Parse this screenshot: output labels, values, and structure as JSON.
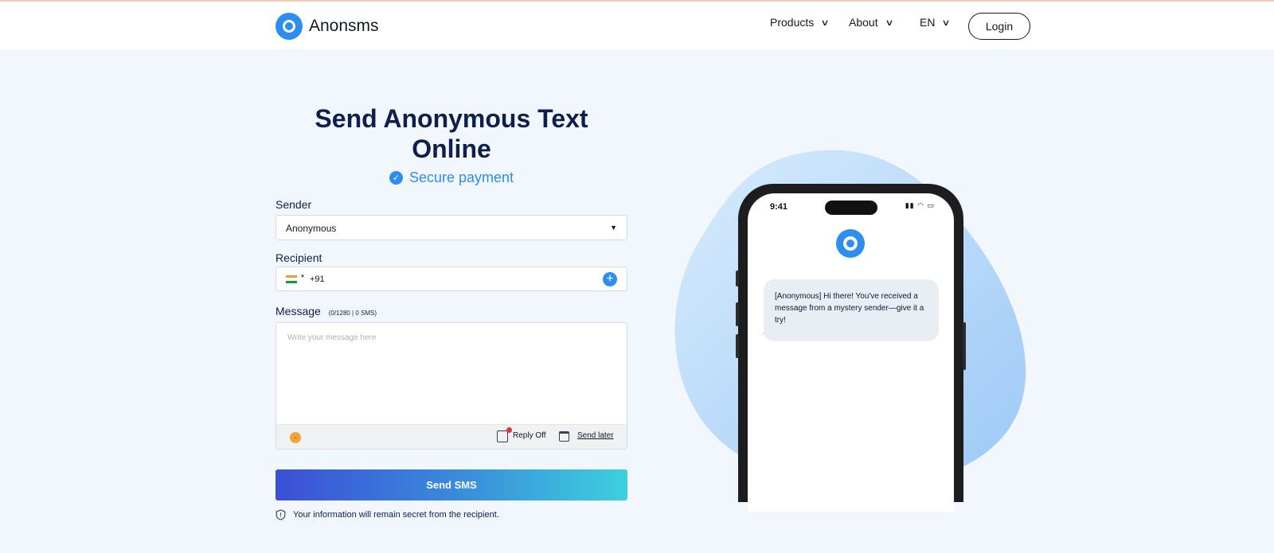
{
  "header": {
    "brand": "Anonsms",
    "nav": [
      {
        "label": "Products",
        "chevron": "∨"
      },
      {
        "label": "About",
        "chevron": "∨"
      },
      {
        "label": "EN",
        "chevron": "∨"
      }
    ],
    "login_label": "Login"
  },
  "hero": {
    "title": "Send Anonymous Text Online",
    "secure_label": "Secure payment"
  },
  "form": {
    "sender_label": "Sender",
    "sender_value": "Anonymous",
    "recipient_label": "Recipient",
    "recipient_country": "India",
    "recipient_dial_code": "+91",
    "message_label": "Message",
    "message_counter": "(0/1280 | 0 SMS)",
    "message_placeholder": "Write your message here",
    "reply_label": "Reply Off",
    "send_later_label": "Send later",
    "send_button_label": "Send SMS",
    "privacy_note": "Your information will remain secret from the recipient."
  },
  "preview": {
    "time": "9:41",
    "message": "[Anonymous] Hi there! You've received a message from a mystery sender—give it a try!"
  },
  "colors": {
    "accent": "#2e8df0",
    "title": "#0c1f4d",
    "background": "#f1f7fd",
    "button_gradient_start": "#3b4fd6",
    "button_gradient_end": "#3dd0dd"
  },
  "icons": [
    "logo-icon",
    "chevron-down-icon",
    "check-circle-icon",
    "caret-down-icon",
    "india-flag-icon",
    "plus-circle-icon",
    "emoji-icon",
    "reply-icon",
    "calendar-icon",
    "shield-icon"
  ]
}
